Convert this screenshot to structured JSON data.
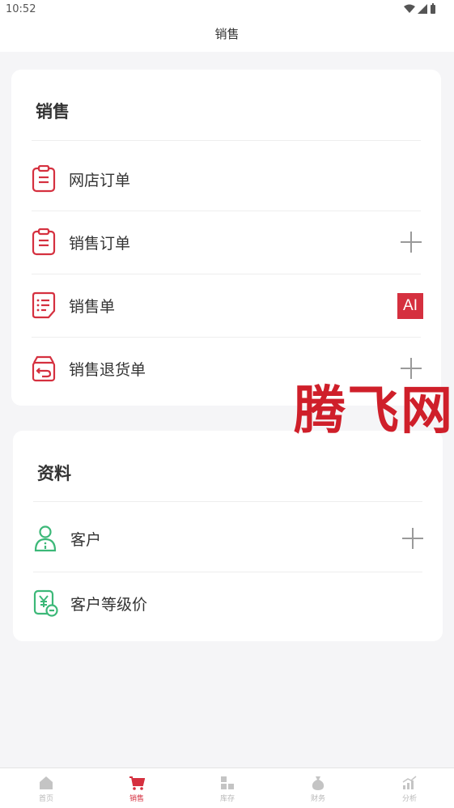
{
  "status_bar": {
    "time": "10:52"
  },
  "header": {
    "title": "销售"
  },
  "sales_card": {
    "title": "销售",
    "items": [
      {
        "label": "网店订单",
        "icon": "clipboard-icon",
        "action": "none"
      },
      {
        "label": "销售订单",
        "icon": "clipboard-icon",
        "action": "plus"
      },
      {
        "label": "销售单",
        "icon": "list-document-icon",
        "action": "ai"
      },
      {
        "label": "销售退货单",
        "icon": "return-box-icon",
        "action": "plus"
      }
    ],
    "ai_label": "AI"
  },
  "data_card": {
    "title": "资料",
    "items": [
      {
        "label": "客户",
        "icon": "customer-icon",
        "action": "plus"
      },
      {
        "label": "客户等级价",
        "icon": "price-tag-icon",
        "action": "none"
      }
    ]
  },
  "watermark": "腾飞网",
  "tabs": [
    {
      "label": "首页",
      "icon": "home-icon",
      "active": false
    },
    {
      "label": "销售",
      "icon": "cart-icon",
      "active": true
    },
    {
      "label": "库存",
      "icon": "inventory-icon",
      "active": false
    },
    {
      "label": "财务",
      "icon": "money-bag-icon",
      "active": false
    },
    {
      "label": "分析",
      "icon": "chart-icon",
      "active": false
    }
  ],
  "colors": {
    "accent": "#d5303f",
    "green": "#3cb878",
    "background": "#f5f5f7"
  }
}
